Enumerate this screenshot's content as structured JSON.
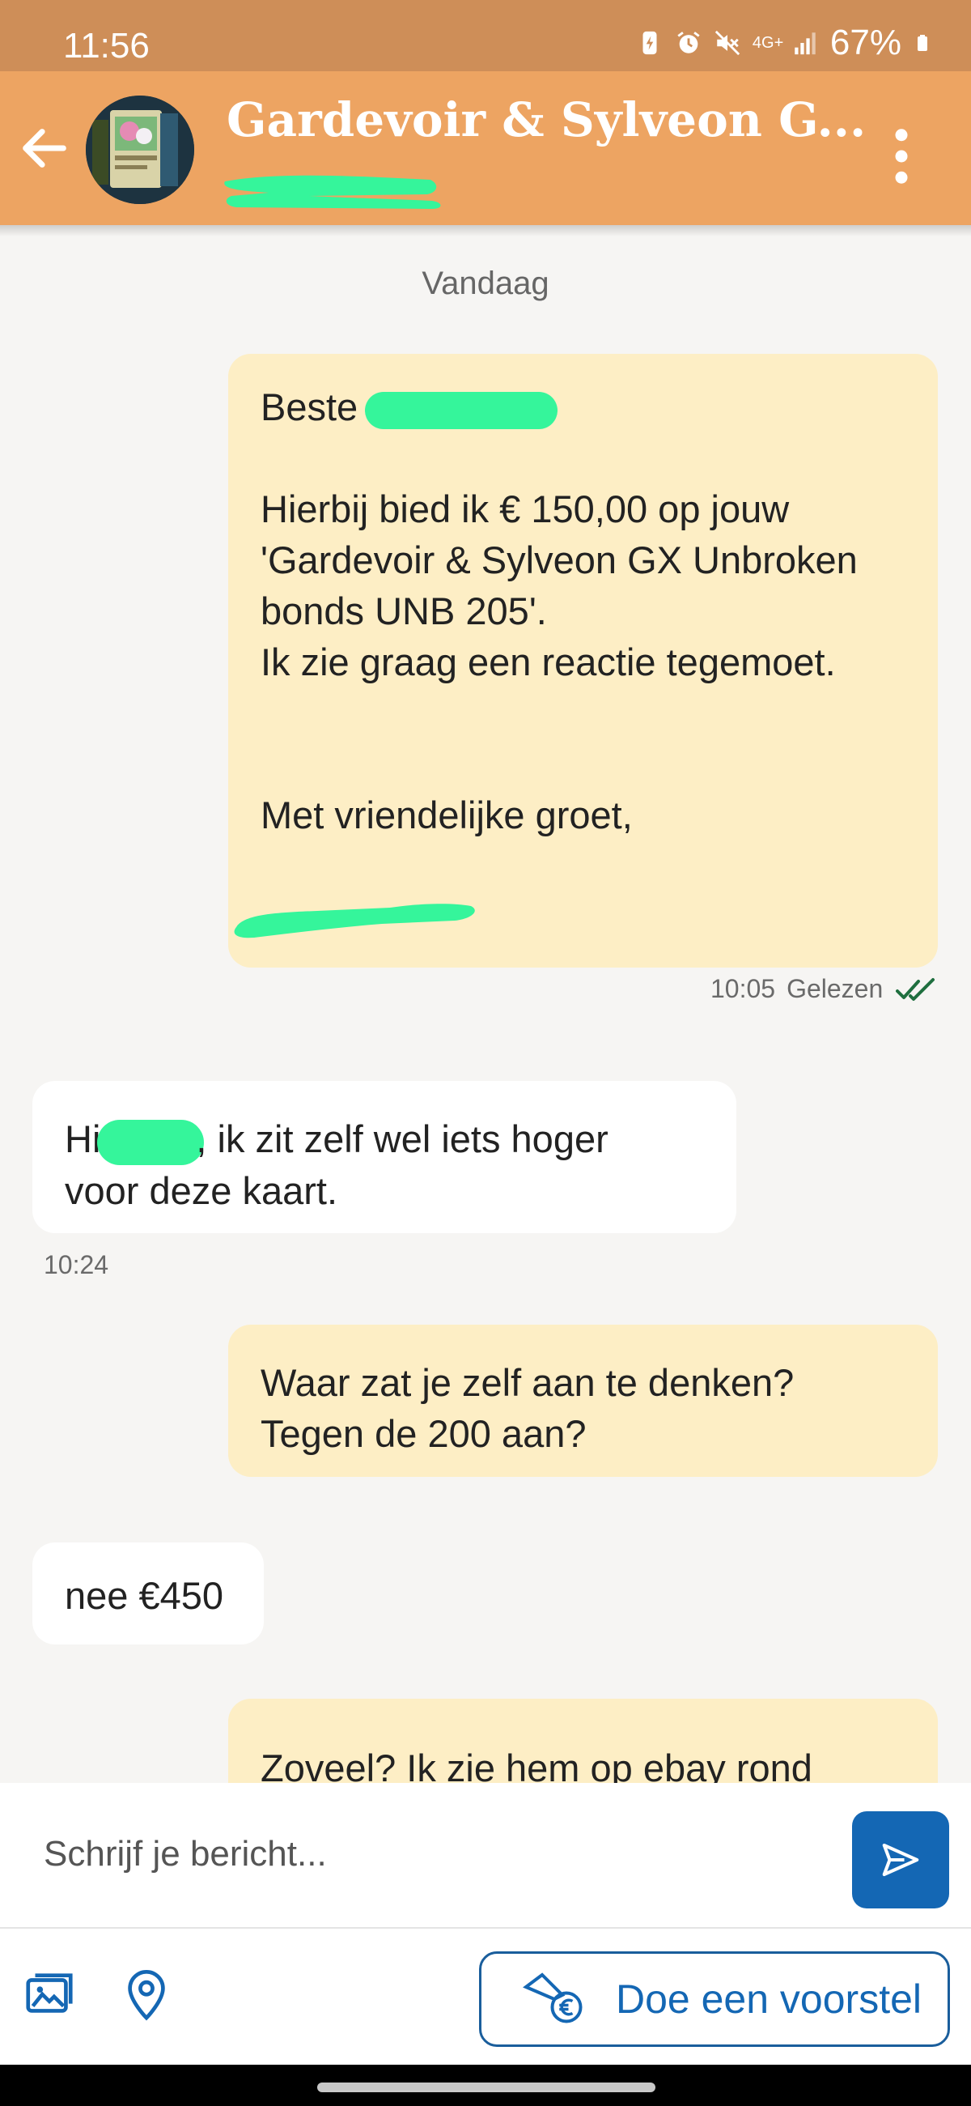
{
  "status_bar": {
    "time": "11:56",
    "network": "4G+",
    "battery": "67%"
  },
  "header": {
    "title": "Gardevoir & Sylveon G...",
    "back_icon": "arrow-left-icon",
    "menu_icon": "more-vertical-icon"
  },
  "conversation": {
    "date_separator": "Vandaag",
    "messages": [
      {
        "direction": "out",
        "lines": [
          "Beste ",
          "",
          "Hierbij bied ik € 150,00 op jouw",
          "'Gardevoir & Sylveon GX Unbroken",
          "bonds UNB 205'.",
          "Ik zie graag een reactie tegemoet.",
          "",
          "",
          "Met vriendelijke groet,"
        ],
        "time": "10:05",
        "status": "Gelezen"
      },
      {
        "direction": "in",
        "line1_a": "Hi",
        "line1_b": ", ik zit zelf wel iets hoger",
        "line2": "voor deze kaart.",
        "time": "10:24"
      },
      {
        "direction": "out",
        "lines": [
          "Waar zat je zelf aan te denken?",
          "Tegen de 200 aan?"
        ]
      },
      {
        "direction": "in",
        "text": "nee €450"
      },
      {
        "direction": "out",
        "text": "Zoveel? Ik zie hem op ebay rond"
      }
    ]
  },
  "composer": {
    "placeholder": "Schrijf je bericht...",
    "send_icon": "send-icon"
  },
  "toolbar": {
    "gallery_icon": "image-gallery-icon",
    "location_icon": "location-pin-icon",
    "offer_label": "Doe een voorstel",
    "offer_icon": "offer-hand-euro-icon"
  },
  "colors": {
    "header": "#eda462",
    "status_bar": "#ce8e58",
    "outgoing_bubble": "#fdeec5",
    "incoming_bubble": "#ffffff",
    "accent": "#1467b4",
    "redaction": "#35f59b"
  }
}
